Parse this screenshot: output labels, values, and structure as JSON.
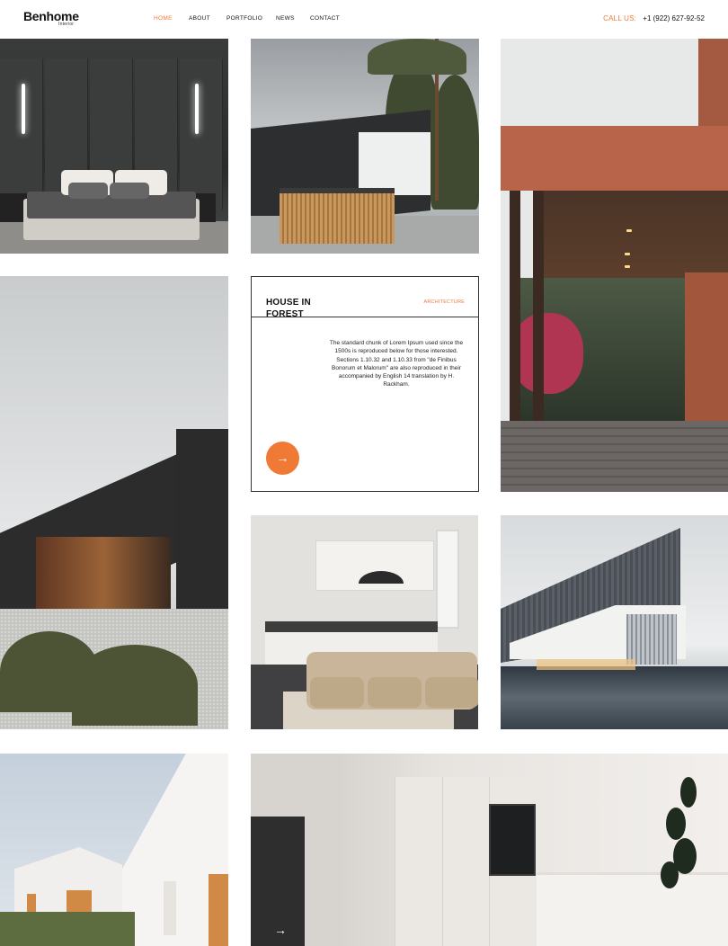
{
  "brand": {
    "name": "Benhome",
    "tagline": "Interior"
  },
  "nav": {
    "items": [
      {
        "label": "HOME",
        "active": true
      },
      {
        "label": "ABOUT",
        "active": false
      },
      {
        "label": "PORTFOLIO",
        "active": false
      },
      {
        "label": "NEWS",
        "active": false
      },
      {
        "label": "CONTACT",
        "active": false
      }
    ]
  },
  "contact": {
    "label": "CALL US:",
    "phone": "+1 (922) 627-92-52"
  },
  "colors": {
    "accent": "#f07a35",
    "text": "#111111",
    "border": "#333333"
  },
  "gallery": [
    {
      "name": "bedroom",
      "alt": "bedroom interior"
    },
    {
      "name": "forest-house",
      "alt": "house in forest exterior"
    },
    {
      "name": "terracotta-porch",
      "alt": "terracotta house porch"
    },
    {
      "name": "concrete-house",
      "alt": "dark brick house"
    },
    {
      "name": "kitchen",
      "alt": "kitchen with sofa"
    },
    {
      "name": "modern-building",
      "alt": "modern angular building"
    },
    {
      "name": "white-house",
      "alt": "white house"
    },
    {
      "name": "interior",
      "alt": "minimal kitchen interior"
    }
  ],
  "card": {
    "title": "HOUSE IN FOREST",
    "category": "ARCHITECTURE",
    "description": "The standard chunk of Lorem Ipsum used since the 1500s is reproduced below for those interested. Sections 1.10.32 and 1.10.33 from \"de Finibus Bonorum et Malorum\" are also reproduced in their accompanied by English 14 translation by H. Rackham.",
    "button_icon": "arrow-right-icon",
    "button_glyph": "→"
  },
  "interior_tile": {
    "arrow_icon": "arrow-right-icon",
    "arrow_glyph": "→"
  }
}
